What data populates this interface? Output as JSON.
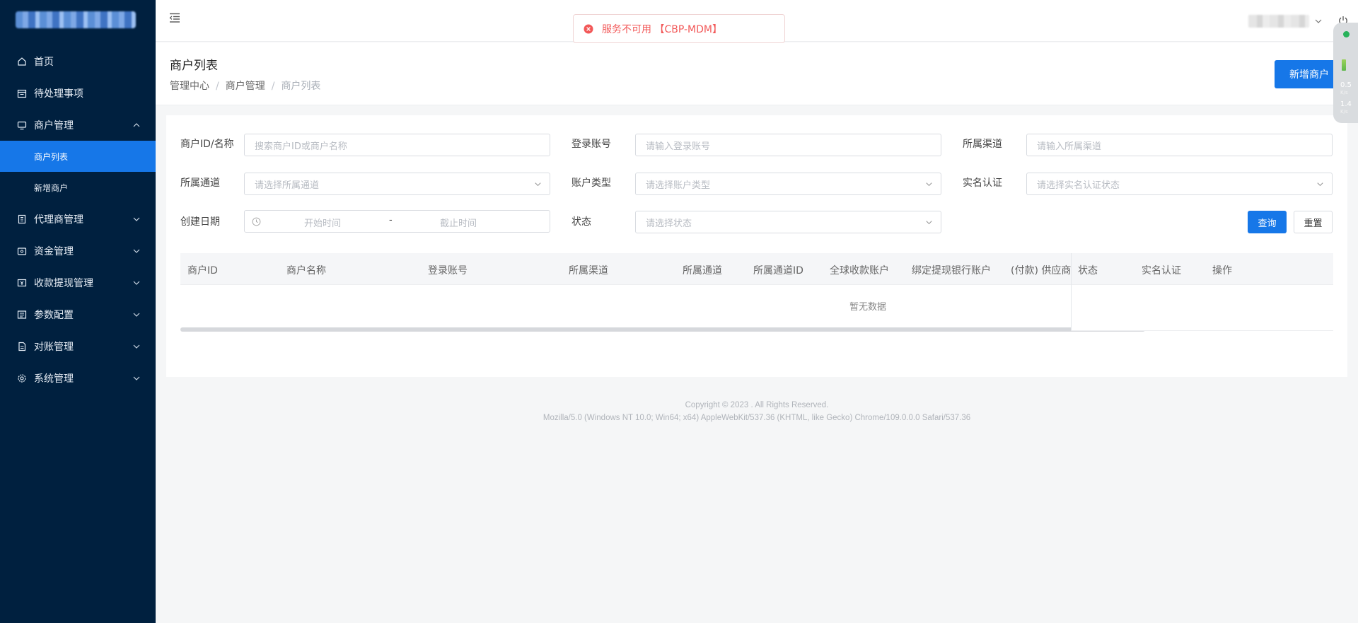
{
  "sidebar": {
    "items": [
      {
        "label": "首页",
        "icon": "home-icon"
      },
      {
        "label": "待处理事项",
        "icon": "calendar-icon"
      },
      {
        "label": "商户管理",
        "icon": "monitor-icon",
        "expanded": true,
        "children": [
          {
            "label": "商户列表",
            "active": true
          },
          {
            "label": "新增商户"
          }
        ]
      },
      {
        "label": "代理商管理",
        "icon": "building-icon"
      },
      {
        "label": "资金管理",
        "icon": "wallet-icon"
      },
      {
        "label": "收款提现管理",
        "icon": "money-icon"
      },
      {
        "label": "参数配置",
        "icon": "sliders-icon"
      },
      {
        "label": "对账管理",
        "icon": "document-icon"
      },
      {
        "label": "系统管理",
        "icon": "gear-icon"
      }
    ]
  },
  "toast": {
    "message": "服务不可用 【CBP-MDM】",
    "color": "#f25858"
  },
  "page": {
    "title": "商户列表",
    "breadcrumb": [
      "管理中心",
      "商户管理",
      "商户列表"
    ],
    "add_button": "新增商户"
  },
  "filters": {
    "merchant_label": "商户ID/名称",
    "merchant_placeholder": "搜索商户ID或商户名称",
    "login_label": "登录账号",
    "login_placeholder": "请输入登录账号",
    "channel_label": "所属渠道",
    "channel_placeholder": "请输入所属渠道",
    "pass_label": "所属通道",
    "pass_placeholder": "请选择所属通道",
    "acct_type_label": "账户类型",
    "acct_type_placeholder": "请选择账户类型",
    "realname_label": "实名认证",
    "realname_placeholder": "请选择实名认证状态",
    "date_label": "创建日期",
    "date_start": "开始时间",
    "date_sep": "-",
    "date_end": "截止时间",
    "status_label": "状态",
    "status_placeholder": "请选择状态",
    "query_button": "查询",
    "reset_button": "重置"
  },
  "table": {
    "columns": [
      "商户ID",
      "商户名称",
      "登录账号",
      "所属渠道",
      "所属通道",
      "所属通道ID",
      "全球收款账户",
      "绑定提现银行账户",
      "(付款) 供应商"
    ],
    "fixed_columns": [
      "状态",
      "实名认证",
      "操作"
    ],
    "empty_text": "暂无数据"
  },
  "net_widget": {
    "down": "0.5",
    "down_unit": "K/s",
    "up": "1.4",
    "up_unit": "K/s"
  },
  "footer": {
    "copyright": "Copyright © 2023 . All Rights Reserved.",
    "user_agent": "Mozilla/5.0 (Windows NT 10.0; Win64; x64) AppleWebKit/537.36 (KHTML, like Gecko) Chrome/109.0.0.0 Safari/537.36"
  },
  "colors": {
    "sidebar_bg": "#00203f",
    "accent": "#1677e8",
    "error": "#f25858"
  }
}
